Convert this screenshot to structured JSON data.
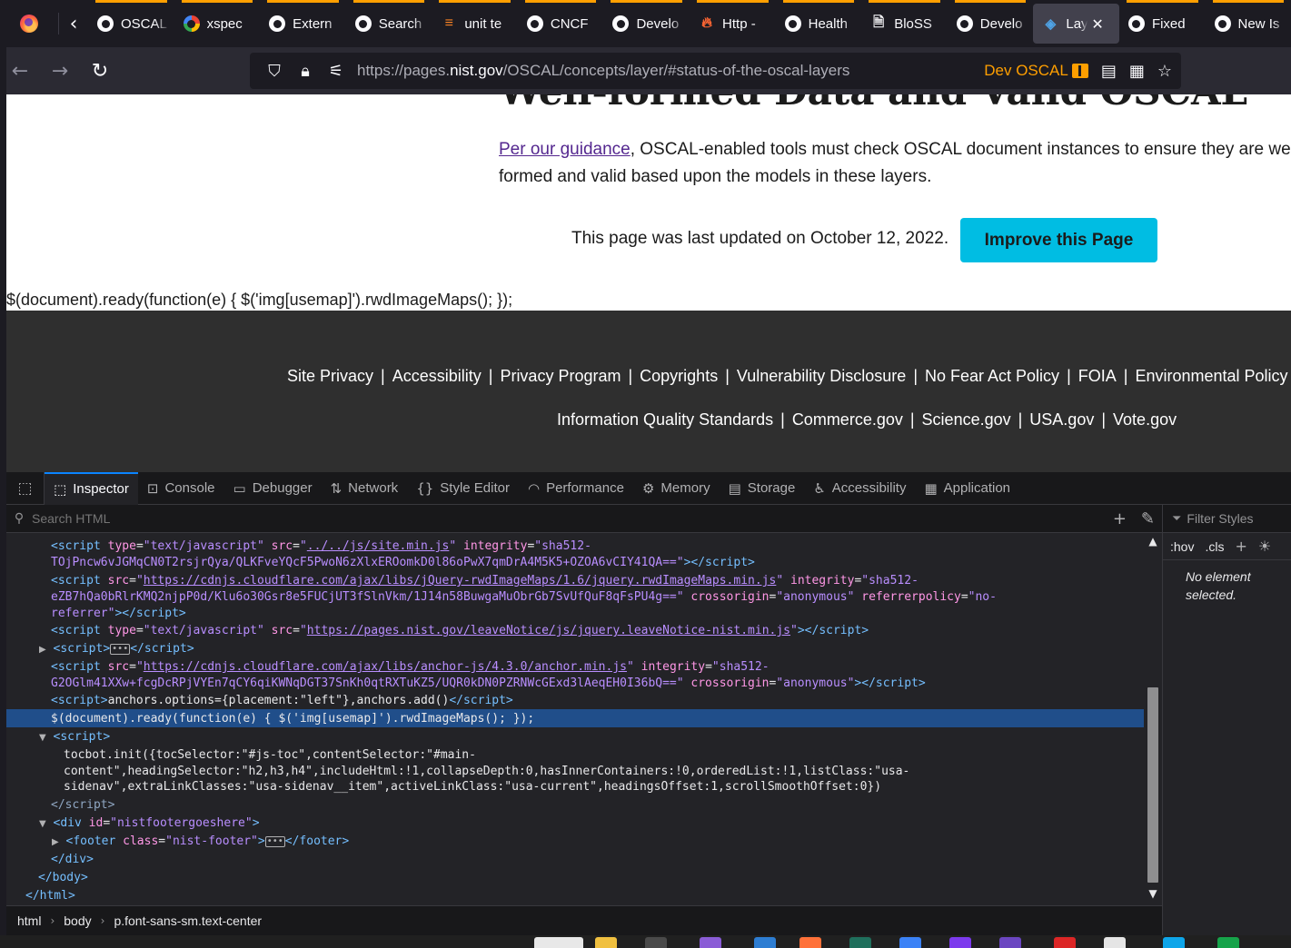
{
  "browser": {
    "tabs": [
      {
        "label": "OSCAL",
        "icon": "github-icon"
      },
      {
        "label": "xspec",
        "icon": "google-icon"
      },
      {
        "label": "Extern",
        "icon": "github-icon"
      },
      {
        "label": "Search",
        "icon": "github-icon"
      },
      {
        "label": "unit te",
        "icon": "stackoverflow-icon"
      },
      {
        "label": "CNCF",
        "icon": "github-icon"
      },
      {
        "label": "Develo",
        "icon": "github-icon"
      },
      {
        "label": "Http -",
        "icon": "fire-icon"
      },
      {
        "label": "Health",
        "icon": "github-icon"
      },
      {
        "label": "BloSS",
        "icon": "document-icon"
      },
      {
        "label": "Develo",
        "icon": "github-icon"
      },
      {
        "label": "Layers",
        "icon": "layers-icon",
        "active": true
      },
      {
        "label": "Fixed",
        "icon": "github-icon"
      },
      {
        "label": "New Is",
        "icon": "github-icon"
      }
    ],
    "url": {
      "prefix": "https://pages.",
      "host": "nist.gov",
      "path": "/OSCAL/concepts/layer/#status-of-the-oscal-layers"
    },
    "container_label": "Dev OSCAL",
    "accent_color": "#ff9f00"
  },
  "page": {
    "heading_partial": "Well-formed Data and Valid OSCAL",
    "para_link": "Per our guidance",
    "para_text": ", OSCAL-enabled tools must check OSCAL document instances to ensure they are well-formed and valid based upon the models in these layers.",
    "updated_text": "This page was last updated on October 12, 2022.",
    "improve_button": "Improve this Page",
    "improve_button_color": "#00bde3",
    "script_text": "$(document).ready(function(e) { $('img[usemap]').rwdImageMaps(); });"
  },
  "footer": {
    "row1": [
      "Site Privacy",
      "Accessibility",
      "Privacy Program",
      "Copyrights",
      "Vulnerability Disclosure",
      "No Fear Act Policy",
      "FOIA",
      "Environmental Policy"
    ],
    "row2": [
      "Information Quality Standards",
      "Commerce.gov",
      "Science.gov",
      "USA.gov",
      "Vote.gov"
    ]
  },
  "devtools": {
    "tabs": [
      {
        "label": "Inspector",
        "icon": "inspector-icon",
        "active": true
      },
      {
        "label": "Console",
        "icon": "console-icon"
      },
      {
        "label": "Debugger",
        "icon": "debugger-icon"
      },
      {
        "label": "Network",
        "icon": "network-icon"
      },
      {
        "label": "Style Editor",
        "icon": "style-editor-icon"
      },
      {
        "label": "Performance",
        "icon": "performance-icon"
      },
      {
        "label": "Memory",
        "icon": "memory-icon"
      },
      {
        "label": "Storage",
        "icon": "storage-icon"
      },
      {
        "label": "Accessibility",
        "icon": "accessibility-icon"
      },
      {
        "label": "Application",
        "icon": "application-icon"
      }
    ],
    "search_placeholder": "Search HTML",
    "filter_styles_placeholder": "Filter Styles",
    "hov_label": ":hov",
    "cls_label": ".cls",
    "no_element": "No element selected.",
    "breadcrumbs": [
      "html",
      "body",
      "p.font-sans-sm.text-center"
    ],
    "selection_color": "#204e8a"
  }
}
